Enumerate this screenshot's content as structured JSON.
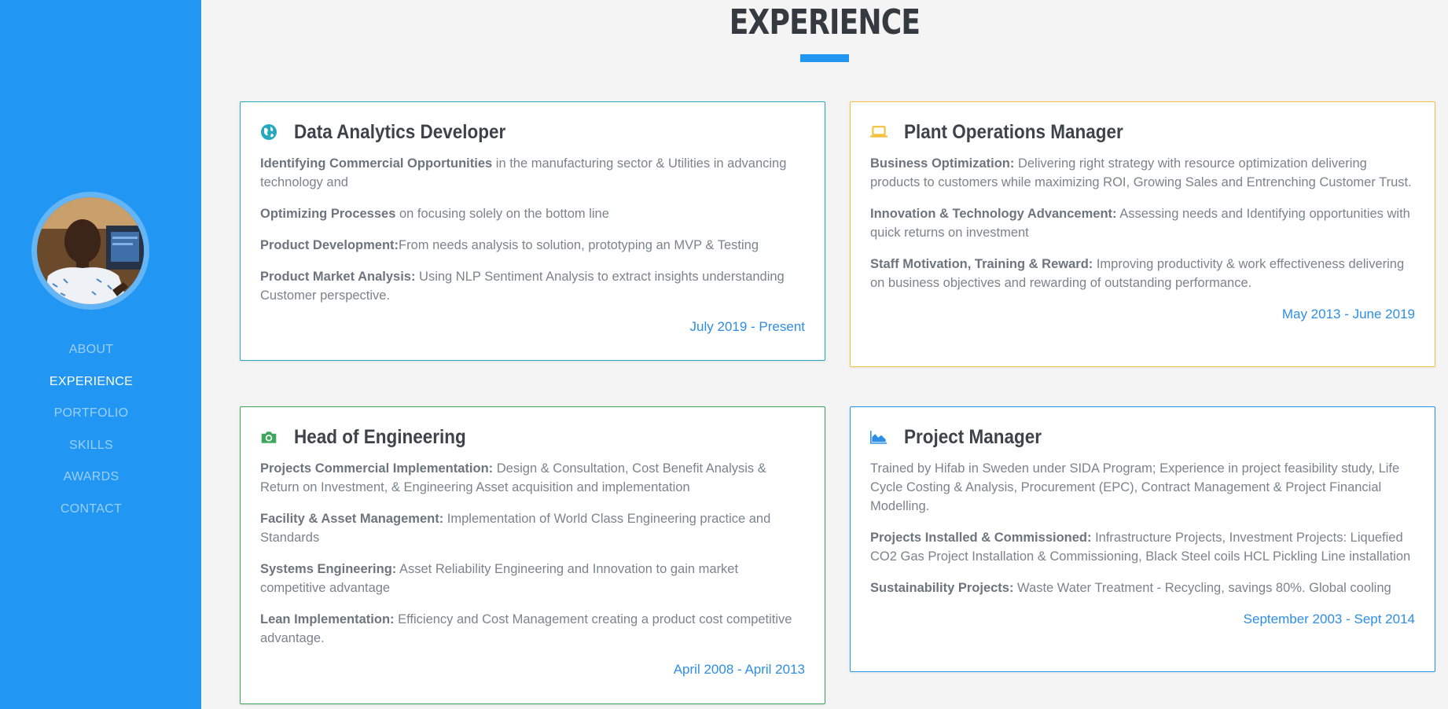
{
  "sidebar": {
    "nav": [
      {
        "label": "ABOUT",
        "active": false
      },
      {
        "label": "EXPERIENCE",
        "active": true
      },
      {
        "label": "PORTFOLIO",
        "active": false
      },
      {
        "label": "SKILLS",
        "active": false
      },
      {
        "label": "AWARDS",
        "active": false
      },
      {
        "label": "CONTACT",
        "active": false
      }
    ]
  },
  "section": {
    "title": "EXPERIENCE"
  },
  "cards": [
    {
      "icon": "globe-icon",
      "title": "Data Analytics Developer",
      "items": [
        {
          "label": "Identifying Commercial Opportunities",
          "text": " in the manufacturing sector & Utilities in advancing technology and"
        },
        {
          "label": "Optimizing Processes",
          "text": " on focusing solely on the bottom line"
        },
        {
          "label": "Product Development:",
          "text": "From needs analysis to solution, prototyping an MVP & Testing"
        },
        {
          "label": "Product Market Analysis:",
          "text": " Using NLP Sentiment Analysis to extract insights understanding Customer perspective."
        }
      ],
      "dates": "July 2019 - Present"
    },
    {
      "icon": "laptop-icon",
      "title": "Plant Operations Manager",
      "items": [
        {
          "label": "Business Optimization:",
          "text": " Delivering right strategy with resource optimization delivering products to customers while maximizing ROI, Growing Sales and Entrenching Customer Trust."
        },
        {
          "label": "Innovation & Technology Advancement:",
          "text": " Assessing needs and Identifying opportunities with quick returns on investment"
        },
        {
          "label": "Staff Motivation, Training & Reward:",
          "text": " Improving productivity & work effectiveness delivering on business objectives and rewarding of outstanding performance."
        }
      ],
      "dates": "May 2013 - June 2019"
    },
    {
      "icon": "camera-icon",
      "title": "Head of Engineering",
      "items": [
        {
          "label": "Projects Commercial Implementation:",
          "text": " Design & Consultation, Cost Benefit Analysis & Return on Investment, & Engineering Asset acquisition and implementation"
        },
        {
          "label": "Facility & Asset Management:",
          "text": " Implementation of World Class Engineering practice and Standards"
        },
        {
          "label": "Systems Engineering:",
          "text": " Asset Reliability Engineering and Innovation to gain market competitive advantage"
        },
        {
          "label": "Lean Implementation:",
          "text": " Efficiency and Cost Management creating a product cost competitive advantage."
        }
      ],
      "dates": "April 2008 - April 2013"
    },
    {
      "icon": "area-chart-icon",
      "title": "Project Manager",
      "items": [
        {
          "label": "",
          "text": "Trained by Hifab in Sweden under SIDA Program; Experience in project feasibility study, Life Cycle Costing & Analysis, Procurement (EPC), Contract Management & Project Financial Modelling."
        },
        {
          "label": "Projects Installed & Commissioned:",
          "text": " Infrastructure Projects, Investment Projects: Liquefied CO2 Gas Project Installation & Commissioning, Black Steel coils HCL Pickling Line installation"
        },
        {
          "label": "Sustainability Projects:",
          "text": " Waste Water Treatment - Recycling, savings 80%. Global cooling"
        }
      ],
      "dates": "September 2003 - Sept 2014"
    }
  ],
  "colors": {
    "sidebar": "#2196f3",
    "accent": "#2196f3",
    "card_borders": [
      "#26a8c0",
      "#f3c13a",
      "#3ca65b",
      "#2196f3"
    ]
  }
}
